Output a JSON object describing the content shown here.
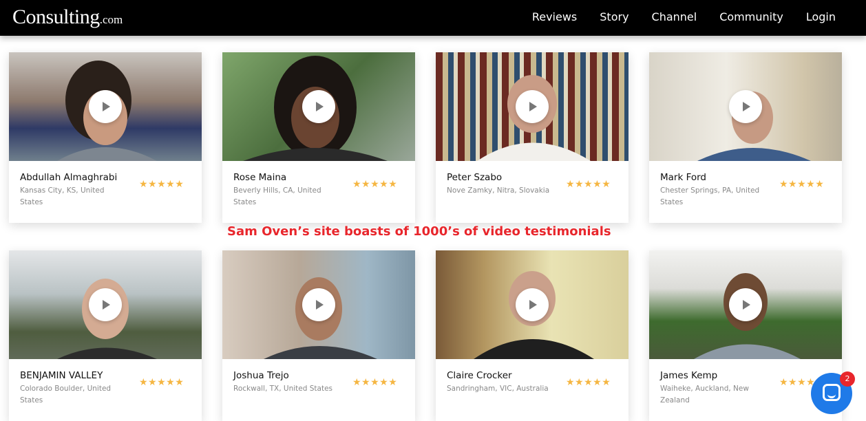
{
  "header": {
    "logo_main": "Consulting",
    "logo_suffix": ".com",
    "nav": [
      "Reviews",
      "Story",
      "Channel",
      "Community",
      "Login"
    ]
  },
  "caption": "Sam Oven’s site boasts of 1000’s of video testimonials",
  "testimonials": [
    {
      "name": "Abdullah Almaghrabi",
      "location": "Kansas City, KS, United States",
      "stars": "★★★★★"
    },
    {
      "name": "Rose Maina",
      "location": "Beverly Hills, CA, United States",
      "stars": "★★★★★"
    },
    {
      "name": "Peter Szabo",
      "location": "Nove Zamky, Nitra, Slovakia",
      "stars": "★★★★★"
    },
    {
      "name": "Mark Ford",
      "location": "Chester Springs, PA, United States",
      "stars": "★★★★★"
    },
    {
      "name": "BENJAMIN VALLEY",
      "location": "Colorado Boulder, United States",
      "stars": "★★★★★"
    },
    {
      "name": "Joshua Trejo",
      "location": "Rockwall, TX, United States",
      "stars": "★★★★★"
    },
    {
      "name": "Claire Crocker",
      "location": "Sandringham, VIC, Australia",
      "stars": "★★★★★"
    },
    {
      "name": "James Kemp",
      "location": "Waiheke, Auckland, New Zealand",
      "stars": "★★★★★"
    }
  ],
  "chat_widget": {
    "badge_count": "2"
  },
  "colors": {
    "header_bg": "#000000",
    "star": "#f5b642",
    "caption": "#e8262c",
    "chat": "#1f7ae8"
  }
}
